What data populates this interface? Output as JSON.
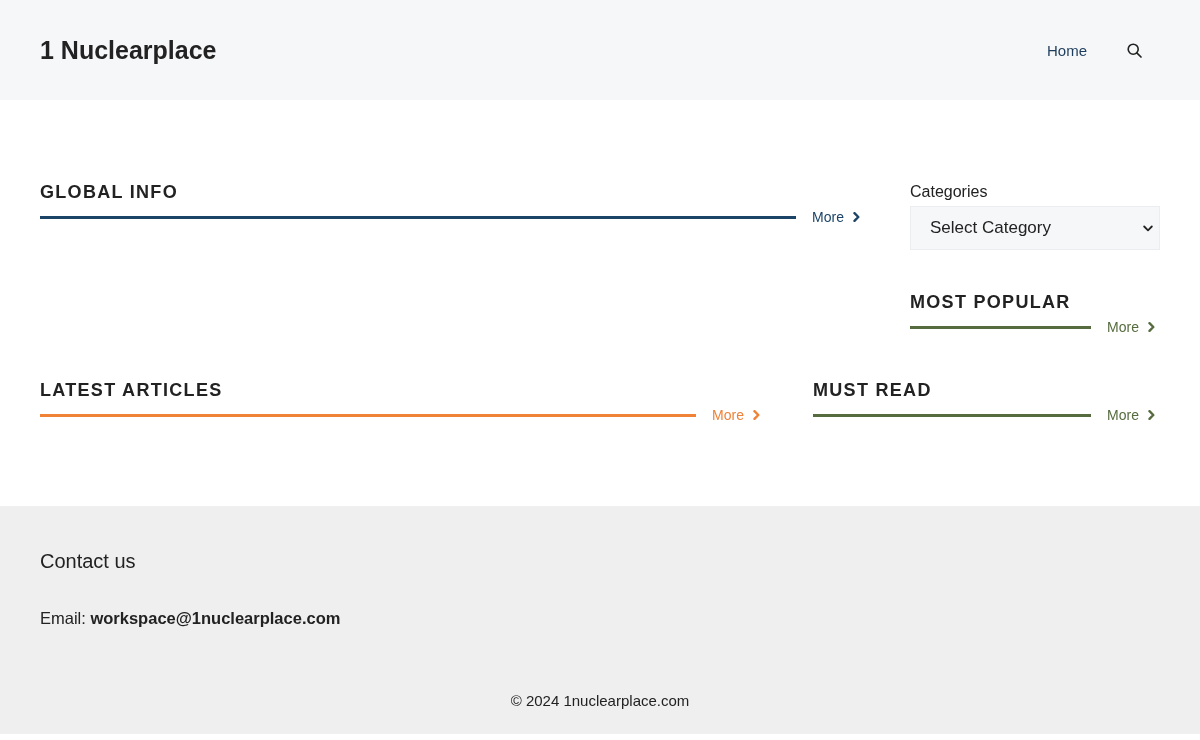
{
  "header": {
    "site_title": "1 Nuclearplace",
    "nav": [
      {
        "label": "Home"
      }
    ]
  },
  "top_sections": [
    {
      "title": "GLOBAL INFO",
      "more": "More",
      "color": "#1b4467"
    }
  ],
  "sidebar": {
    "categories_label": "Categories",
    "category_select": {
      "value": "Select Category"
    },
    "sections": [
      {
        "title": "MOST POPULAR",
        "more": "More",
        "color": "#566b3e"
      }
    ]
  },
  "bottom_sections": [
    {
      "title": "LATEST ARTICLES",
      "more": "More",
      "color": "#ef8236"
    },
    {
      "title": "MUST READ",
      "more": "More",
      "color": "#566b3e"
    }
  ],
  "footer": {
    "contact_heading": "Contact us",
    "email_line": "Email: **workspace@1nuclearplace.com**",
    "copyright": "© 2024 1nuclearplace.com"
  }
}
